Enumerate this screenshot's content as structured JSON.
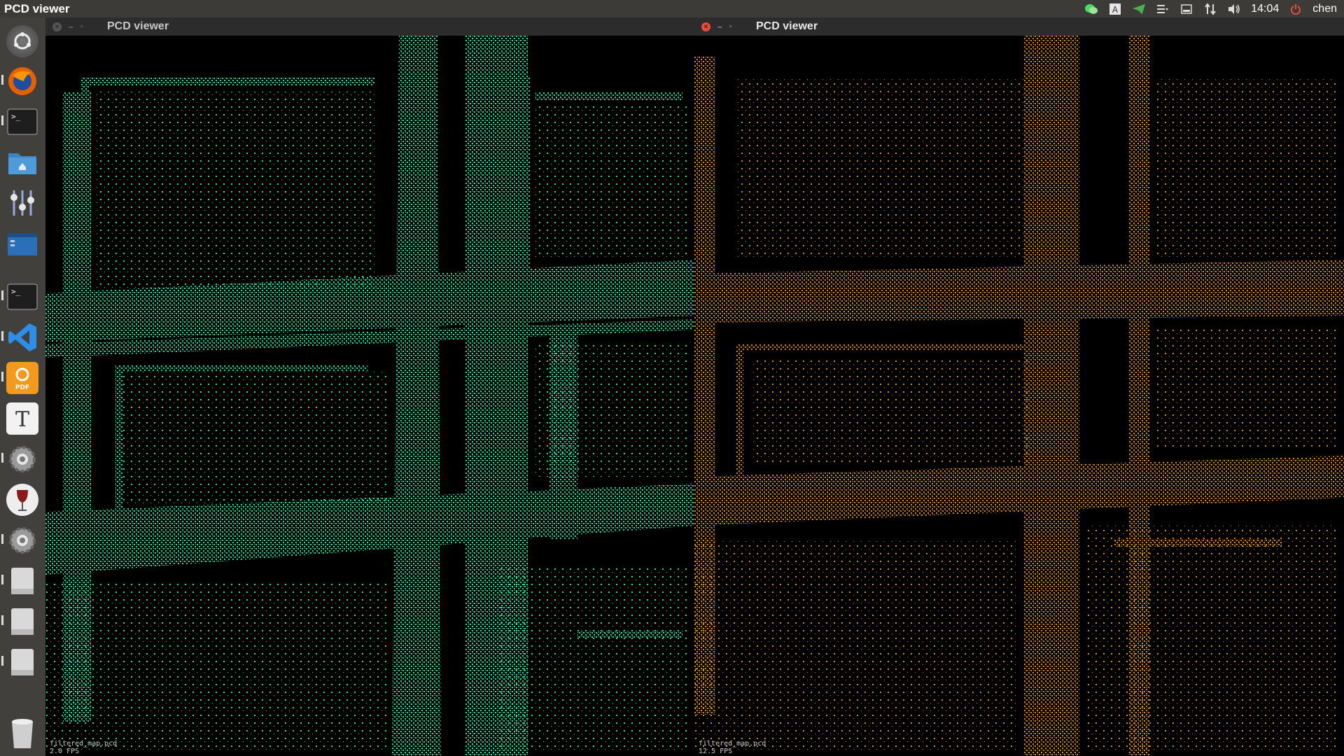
{
  "top_panel": {
    "app_name": "PCD viewer",
    "clock": "14:04",
    "user": "chen",
    "tray_icons": [
      "wechat-icon",
      "keyboard-input-icon",
      "telegram-icon",
      "menu-icon",
      "battery-icon",
      "network-icon",
      "volume-icon",
      "power-icon"
    ]
  },
  "launcher": {
    "items": [
      "dash-home",
      "firefox",
      "terminal",
      "files",
      "settings-mixer",
      "editor",
      "terminal-2",
      "vscode",
      "pdf-reader",
      "text-editor",
      "system-settings",
      "wine",
      "system-settings-2",
      "drive-1",
      "drive-2",
      "drive-3",
      "trash"
    ]
  },
  "windows": [
    {
      "title": "PCD viewer",
      "footer_file": "filtered_map.pcd",
      "footer_fps": "2.0 FPS",
      "point_color": "#1fe0a8",
      "active": false
    },
    {
      "title": "PCD viewer",
      "footer_file": "filtered_map.pcd",
      "footer_fps": "12.5 FPS",
      "point_color": "#d68a1e",
      "active": true
    }
  ]
}
